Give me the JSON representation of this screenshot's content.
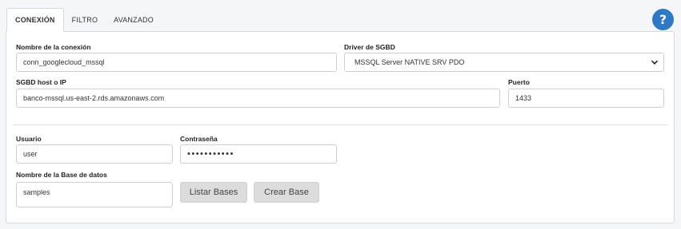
{
  "tabs": [
    {
      "label": "CONEXIÓN",
      "active": true
    },
    {
      "label": "FILTRO",
      "active": false
    },
    {
      "label": "AVANZADO",
      "active": false
    }
  ],
  "help": {
    "icon": "help-icon",
    "glyph": "?",
    "color": "#2d79c7"
  },
  "form": {
    "connection_name": {
      "label": "Nombre de la conexión",
      "value": "conn_googlecloud_mssql"
    },
    "driver": {
      "label": "Driver de SGBD",
      "value": "MSSQL Server NATIVE SRV PDO"
    },
    "host": {
      "label": "SGBD host o IP",
      "value": "banco-mssql.us-east-2.rds.amazonaws.com"
    },
    "port": {
      "label": "Puerto",
      "value": "1433"
    },
    "user": {
      "label": "Usuario",
      "value": "user"
    },
    "password": {
      "label": "Contraseña",
      "value": "•••••••••••"
    },
    "database": {
      "label": "Nombre de la Base de datos",
      "value": "samples"
    }
  },
  "buttons": {
    "list_dbs": "Listar Bases",
    "create_db": "Crear Base"
  }
}
